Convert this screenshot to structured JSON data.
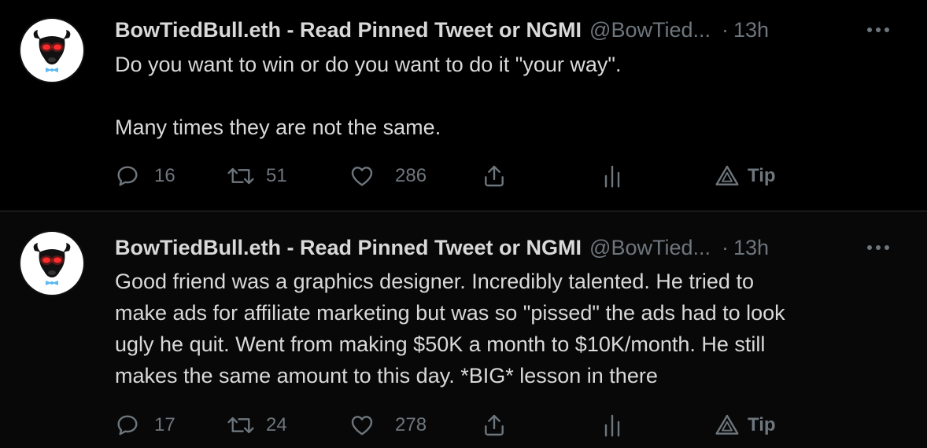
{
  "tweets": [
    {
      "author_name": "BowTiedBull.eth - Read Pinned Tweet or NGMI",
      "handle": "@BowTied...",
      "dot": "·",
      "time": "13h",
      "text": "Do you want to win or do you want to do it \"your way\".\n\nMany times they are not the same.",
      "replies": "16",
      "retweets": "51",
      "likes": "286",
      "tip_label": "Tip"
    },
    {
      "author_name": "BowTiedBull.eth - Read Pinned Tweet or NGMI",
      "handle": "@BowTied...",
      "dot": "·",
      "time": "13h",
      "text": "Good friend was a graphics designer. Incredibly talented. He tried to\nmake ads for affiliate marketing but was so \"pissed\" the ads had to look\nugly he quit. Went from making $50K a month to $10K/month. He still\nmakes the same amount to this day. *BIG* lesson in there",
      "replies": "17",
      "retweets": "24",
      "likes": "278",
      "tip_label": "Tip"
    }
  ],
  "colors": {
    "background": "#000000",
    "text_primary": "#d9d9d9",
    "text_secondary": "#6e767d",
    "divider": "#2f3336",
    "avatar_eyes": "#ff2a2a",
    "bowtie": "#5bb8f0"
  },
  "icons": [
    "bull-avatar",
    "more-icon",
    "reply-icon",
    "retweet-icon",
    "like-icon",
    "share-icon",
    "analytics-icon",
    "tip-icon"
  ]
}
